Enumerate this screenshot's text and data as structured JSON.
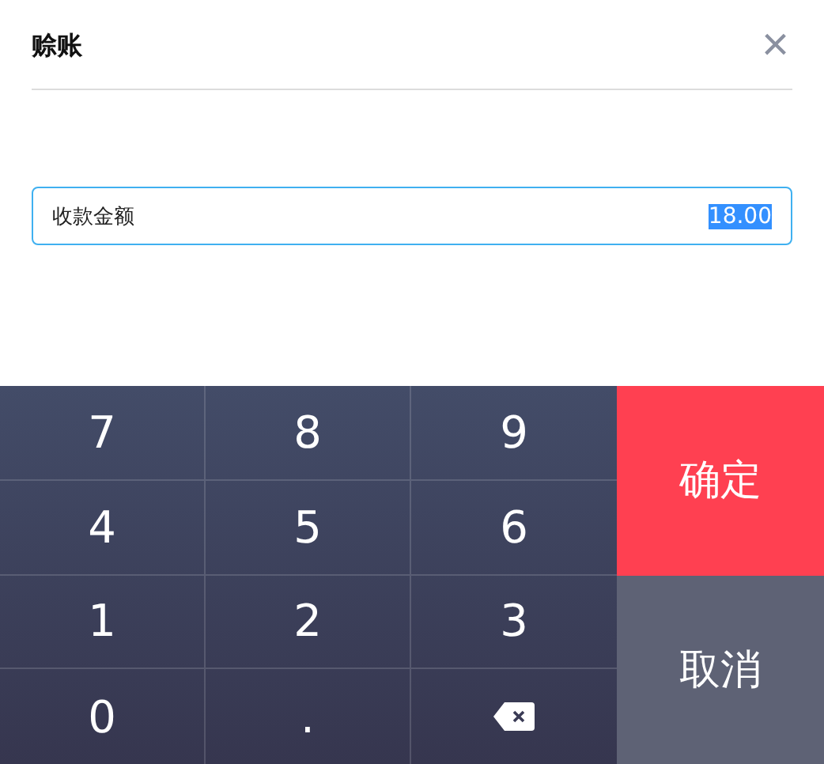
{
  "dialog": {
    "title": "赊账",
    "close": "×"
  },
  "amount_field": {
    "label": "收款金额",
    "value": "18.00",
    "value_selected": true
  },
  "keypad": {
    "keys": [
      {
        "kind": "digit",
        "label": "7"
      },
      {
        "kind": "digit",
        "label": "8"
      },
      {
        "kind": "digit",
        "label": "9"
      },
      {
        "kind": "digit",
        "label": "4"
      },
      {
        "kind": "digit",
        "label": "5"
      },
      {
        "kind": "digit",
        "label": "6"
      },
      {
        "kind": "digit",
        "label": "1"
      },
      {
        "kind": "digit",
        "label": "2"
      },
      {
        "kind": "digit",
        "label": "3"
      },
      {
        "kind": "digit",
        "label": "0"
      },
      {
        "kind": "digit",
        "label": "."
      },
      {
        "kind": "backspace"
      }
    ],
    "actions": [
      {
        "kind": "confirm",
        "label": "确定"
      },
      {
        "kind": "cancel",
        "label": "取消"
      }
    ]
  }
}
